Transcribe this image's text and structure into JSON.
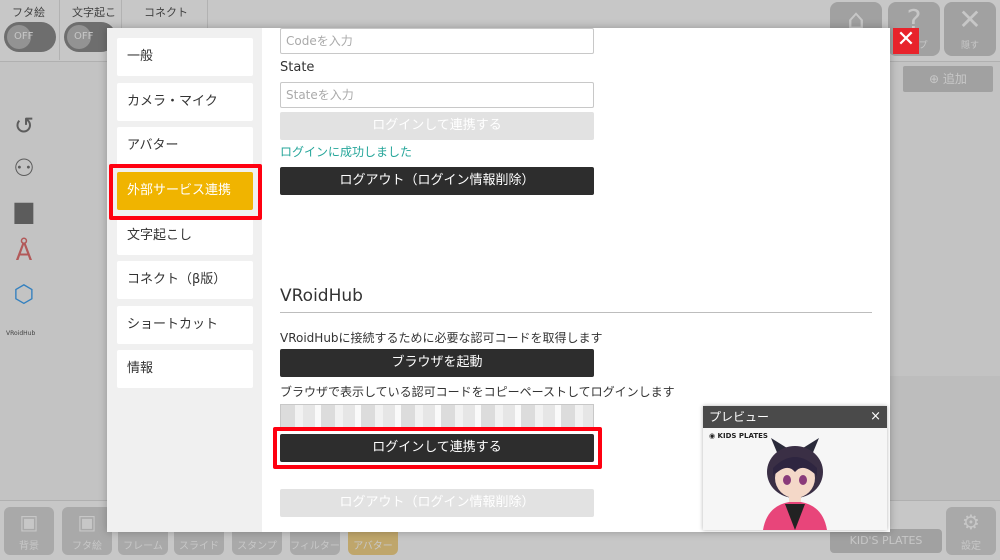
{
  "topbar": {
    "toggles": [
      {
        "label": "フタ絵",
        "state": "OFF"
      },
      {
        "label": "文字起こ",
        "state": "OFF"
      },
      {
        "label": "コネクト",
        "state": ""
      }
    ],
    "hide_label": "隠す",
    "help_label": "ヘルプ"
  },
  "add_button": {
    "label": "追加"
  },
  "sidebar": {
    "vroidhub_label": "VRoidHub"
  },
  "bottombar": {
    "items": [
      {
        "label": "背景"
      },
      {
        "label": "フタ絵"
      },
      {
        "label": "フレーム"
      },
      {
        "label": "スライド"
      },
      {
        "label": "スタンプ"
      },
      {
        "label": "フィルター"
      },
      {
        "label": "アバター"
      }
    ],
    "settings_label": "設定",
    "brand": "KID'S PLATES"
  },
  "modal": {
    "nav": [
      {
        "label": "一般"
      },
      {
        "label": "カメラ・マイク"
      },
      {
        "label": "アバター"
      },
      {
        "label": "外部サービス連携"
      },
      {
        "label": "文字起こし"
      },
      {
        "label": "コネクト（β版）"
      },
      {
        "label": "ショートカット"
      },
      {
        "label": "情報"
      }
    ],
    "code_placeholder": "Codeを入力",
    "state_label": "State",
    "state_placeholder": "Stateを入力",
    "login_link_button": "ログインして連携する",
    "login_success": "ログインに成功しました",
    "logout_button": "ログアウト（ログイン情報削除）",
    "vroidhub": {
      "title": "VRoidHub",
      "desc1": "VRoidHubに接続するために必要な認可コードを取得します",
      "browser_button": "ブラウザを起動",
      "desc2": "ブラウザで表示している認可コードをコピーペーストしてログインします",
      "login_button": "ログインして連携する",
      "logout_button": "ログアウト（ログイン情報削除）"
    }
  },
  "preview": {
    "title": "プレビュー",
    "close": "×",
    "brand": "KIDS PLATES"
  },
  "colors": {
    "accent": "#f0b400",
    "highlight": "#ff0010",
    "success": "#26a69a",
    "dark_button": "#2d2d2d"
  }
}
